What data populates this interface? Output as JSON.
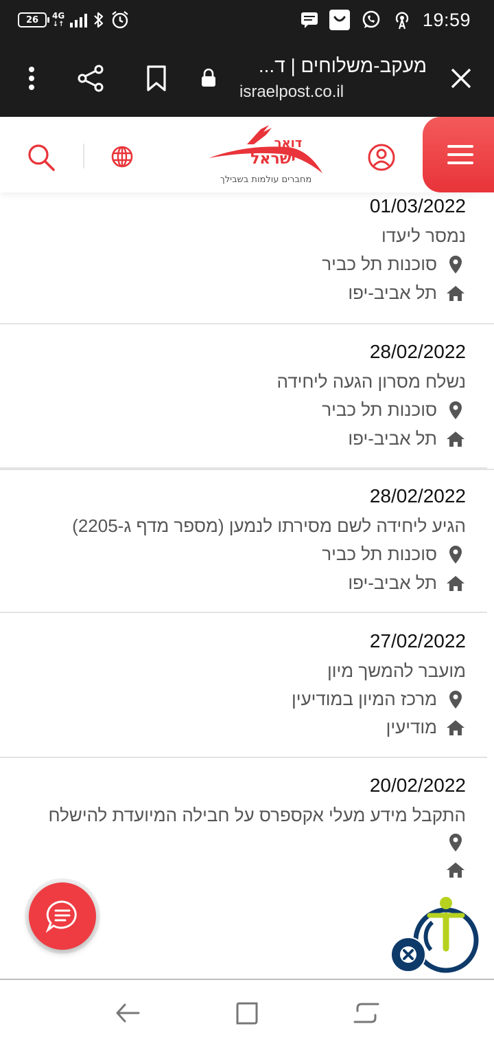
{
  "status_bar": {
    "battery_level": "26",
    "network_type": "4G",
    "time": "19:59",
    "left_icons": [
      "battery-icon",
      "4g-icon",
      "signal-icon",
      "bluetooth-icon",
      "alarm-icon"
    ],
    "right_icons": [
      "message-icon",
      "shopping-icon",
      "whatsapp-icon",
      "hotspot-icon"
    ]
  },
  "browser": {
    "page_title": "מעקב-משלוחים | ד...",
    "url": "israelpost.co.il",
    "icons": [
      "close-icon",
      "lock-icon",
      "bookmark-icon",
      "share-icon",
      "more-icon"
    ]
  },
  "site_header": {
    "logo_text": "דואר ישראל",
    "logo_tagline": "מחברים עולמות בשבילך",
    "brand_color": "#e8343a",
    "icons": [
      "menu-icon",
      "user-icon",
      "globe-icon",
      "search-icon"
    ]
  },
  "tracking": {
    "entries": [
      {
        "date": "01/03/2022",
        "status": "נמסר ליעדו",
        "branch": "סוכנות תל כביר",
        "city": "תל אביב-יפו"
      },
      {
        "date": "28/02/2022",
        "status": "נשלח מסרון הגעה ליחידה",
        "branch": "סוכנות תל כביר",
        "city": "תל אביב-יפו"
      },
      {
        "date": "28/02/2022",
        "status": "הגיע ליחידה לשם מסירתו לנמען (מספר מדף ג-2205)",
        "branch": "סוכנות תל כביר",
        "city": "תל אביב-יפו"
      },
      {
        "date": "27/02/2022",
        "status": "מועבר להמשך מיון",
        "branch": "מרכז המיון במודיעין",
        "city": "מודיעין"
      },
      {
        "date": "20/02/2022",
        "status": "התקבל מידע מעלי אקספרס על חבילה המיועדת להישלח",
        "branch": "",
        "city": ""
      }
    ],
    "row_icons": [
      "location-pin-icon",
      "home-icon"
    ]
  },
  "floating": {
    "chat_icon": "chat-icon",
    "accessibility_icon": "accessibility-icon",
    "close_icon": "close-icon"
  },
  "nav_bar": {
    "icons": [
      "back-icon",
      "home-square-icon",
      "recents-icon"
    ]
  }
}
